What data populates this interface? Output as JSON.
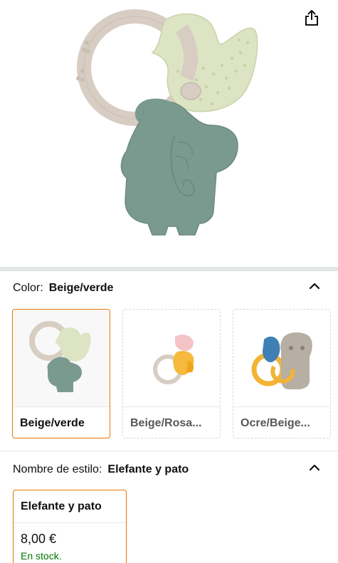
{
  "product_image": {
    "alt": ""
  },
  "toolbar": {
    "share_icon": "share-icon"
  },
  "color": {
    "key_label": "Color:",
    "selected_value": "Beige/verde",
    "collapse_icon": "chevron-up-icon",
    "options": [
      {
        "label": "Beige/verde",
        "selected": true
      },
      {
        "label": "Beige/Rosa...",
        "selected": false
      },
      {
        "label": "Ocre/Beige...",
        "selected": false
      }
    ]
  },
  "style": {
    "key_label": "Nombre de estilo:",
    "selected_value": "Elefante y pato",
    "collapse_icon": "chevron-up-icon",
    "options": [
      {
        "label": "Elefante y pato",
        "price": "8,00 €",
        "stock": "En stock.",
        "selected": true
      }
    ]
  },
  "colors": {
    "accent_selected": "#e77600",
    "stock_green": "#007600",
    "divider": "#e3e6e6"
  }
}
